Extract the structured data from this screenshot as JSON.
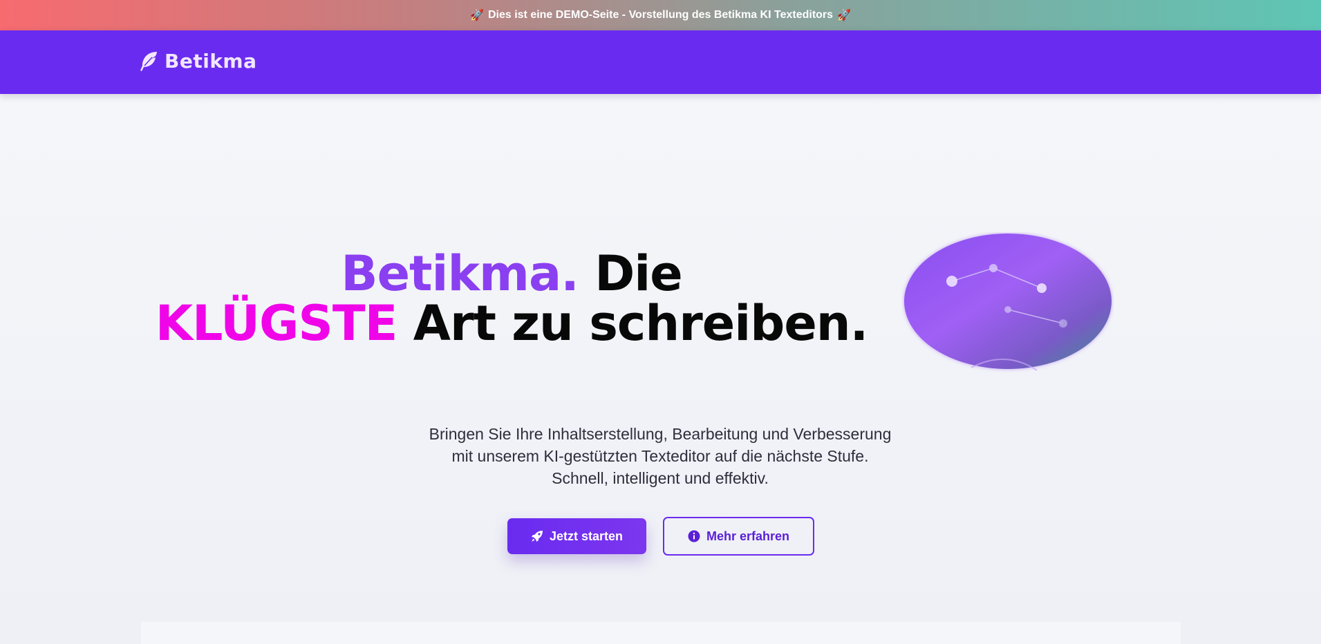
{
  "banner": {
    "text": "Dies ist eine DEMO-Seite - Vorstellung des Betikma KI Texteditors",
    "icon": "rocket-emoji",
    "gradient_start": "#f76b6f",
    "gradient_end": "#5ec6b5"
  },
  "navbar": {
    "brand_name": "Betikma",
    "brand_icon": "feather-icon",
    "background": "#6a2bf0"
  },
  "hero": {
    "title_brand": "Betikma.",
    "title_word": "Die",
    "title_accent": "KLÜGSTE",
    "title_rest": "Art zu schreiben.",
    "description_lines": [
      "Bringen Sie Ihre Inhaltserstellung, Bearbeitung und Verbesserung",
      "mit unserem KI-gestützten Texteditor auf die nächste Stufe.",
      "Schnell, intelligent und effektiv."
    ],
    "accent_color": "#f005e8",
    "brand_color": "#8a3ff0"
  },
  "buttons": {
    "primary": {
      "label": "Jetzt starten",
      "icon": "rocket-icon"
    },
    "secondary": {
      "label": "Mehr erfahren",
      "icon": "info-circle-icon"
    }
  },
  "illustration": {
    "name": "brain-network-illustration"
  }
}
